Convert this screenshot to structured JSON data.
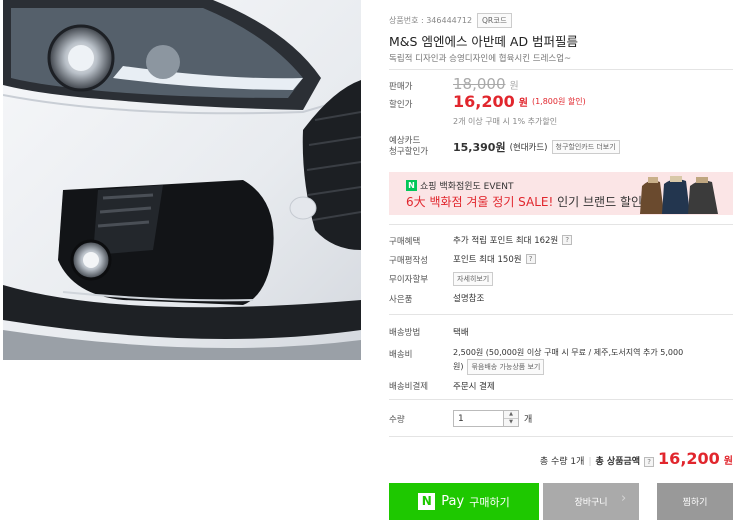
{
  "product": {
    "number_label": "상품번호 : 346444712",
    "qr_label": "QR코드",
    "title": "M&S 엠엔에스 아반떼 AD 범퍼필름",
    "subtitle": "독립적 디자인과 승영디자인에 협육시킨 드레스업~"
  },
  "price": {
    "list_label": "판매가",
    "list_value": "18,000",
    "list_unit": "원",
    "sale_label": "할인가",
    "sale_value": "16,200",
    "sale_unit": "원",
    "discount_note": "(1,800원 할인)",
    "multi_note": "2개 이상 구매 시 1% 추가할인",
    "card_label_1": "예상카드",
    "card_label_2": "청구할인가",
    "card_value": "15,390원",
    "card_name": "(현대카드)",
    "card_btn": "청구할인카드 더보기"
  },
  "banner": {
    "head": "쇼핑 백화점윈도 EVENT",
    "logo": "N",
    "main_red": "6大 백화점 겨울 정기 SALE!",
    "main_rest": " 인기 브랜드 할인"
  },
  "benefits": {
    "buy_label": "구매혜택",
    "buy_value": "추가 적립 포인트 최대 162원",
    "review_label": "구매평작성",
    "review_value": "포인트 최대 150원",
    "interest_label": "무이자할부",
    "interest_btn": "자세히보기",
    "gift_label": "사은품",
    "gift_value": "설명참조"
  },
  "shipping": {
    "method_label": "배송방법",
    "method_value": "택배",
    "fee_label": "배송비",
    "fee_line1": "2,500원   (50,000원 이상 구매 시 무료 / 제주,도서지역 추가 5,000",
    "fee_line2": "원)",
    "fee_btn": "묶음배송 가능상품 보기",
    "pay_label": "배송비결제",
    "pay_value": "주문시 결제"
  },
  "quantity": {
    "label": "수량",
    "value": "1",
    "unit": "개"
  },
  "total": {
    "count": "총 수량 1개",
    "label": "총 상품금액",
    "value": "16,200",
    "unit": "원"
  },
  "actions": {
    "pay_n": "N",
    "pay_word": "Pay",
    "pay_label": "구매하기",
    "cart_label": "장바구니",
    "wish_label": "찜하기"
  },
  "colors": {
    "sale_red": "#e1262d",
    "naver_green": "#1ec800",
    "banner_bg": "#fbe5e6"
  }
}
